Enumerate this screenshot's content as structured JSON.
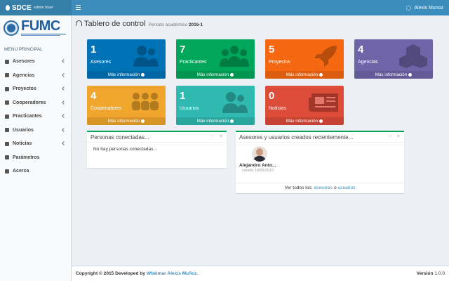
{
  "app": {
    "logo_name": "SDCE",
    "logo_sub": "admin blue!",
    "user_name": "Alexis Munoz"
  },
  "sidebar": {
    "brand": "FUMC",
    "menu_header": "MENU PRINCIPAL",
    "items": [
      {
        "label": "Asesores",
        "icon": "users-icon",
        "has_submenu": true
      },
      {
        "label": "Agencias",
        "icon": "cubes-icon",
        "has_submenu": true
      },
      {
        "label": "Proyectos",
        "icon": "rocket-icon",
        "has_submenu": true
      },
      {
        "label": "Cooperadores",
        "icon": "handshake-icon",
        "has_submenu": true
      },
      {
        "label": "Practicantes",
        "icon": "group-icon",
        "has_submenu": true
      },
      {
        "label": "Usuarios",
        "icon": "user-icon",
        "has_submenu": true
      },
      {
        "label": "Noticias",
        "icon": "newspaper-icon",
        "has_submenu": true
      },
      {
        "label": "Parámetros",
        "icon": "sliders-icon",
        "has_submenu": false
      },
      {
        "label": "Acerca",
        "icon": "globe-icon",
        "has_submenu": false
      }
    ]
  },
  "header": {
    "title": "Tablero de control",
    "subtitle": "Periodo académico",
    "period": "2016-1"
  },
  "stats": [
    {
      "count": "1",
      "label": "Asesores",
      "link": "Más información",
      "color": "#0073b7",
      "icon": "users-icon"
    },
    {
      "count": "7",
      "label": "Practicantes",
      "link": "Más información",
      "color": "#00a65a",
      "icon": "group-icon"
    },
    {
      "count": "5",
      "label": "Proyectos",
      "link": "Más información",
      "color": "#f56811",
      "icon": "rocket-icon"
    },
    {
      "count": "4",
      "label": "Agencias",
      "link": "Más información",
      "color": "#6f64a8",
      "icon": "cubes-icon"
    },
    {
      "count": "4",
      "label": "Cooperadores",
      "link": "Más información",
      "color": "#f0a52c",
      "icon": "handshake-icon"
    },
    {
      "count": "1",
      "label": "Usuarios",
      "link": "Más información",
      "color": "#2fb9b0",
      "icon": "users-icon"
    },
    {
      "count": "0",
      "label": "Noticias",
      "link": "Más información",
      "color": "#dd4b39",
      "icon": "newspaper-icon"
    }
  ],
  "connected_panel": {
    "title": "Personas conectadas...",
    "empty_text": "No hay personas conectadas...",
    "minimize": "−",
    "close": "×"
  },
  "recent_panel": {
    "title": "Asesores y usuarios creados recientemente...",
    "minimize": "−",
    "close": "×",
    "user_name": "Alejandro Anto...",
    "user_date": "creado 18/05/2015",
    "view_all_prefix": "Ver todos los:",
    "link_asesores": "asesores",
    "link_conj": "o",
    "link_usuarios": "usuarios"
  },
  "footer": {
    "copyright": "Copyright © 2015 Developed by",
    "author": "Wbeimar Alexis Muñoz.",
    "version_label": "Versión",
    "version": "1.0.0"
  }
}
